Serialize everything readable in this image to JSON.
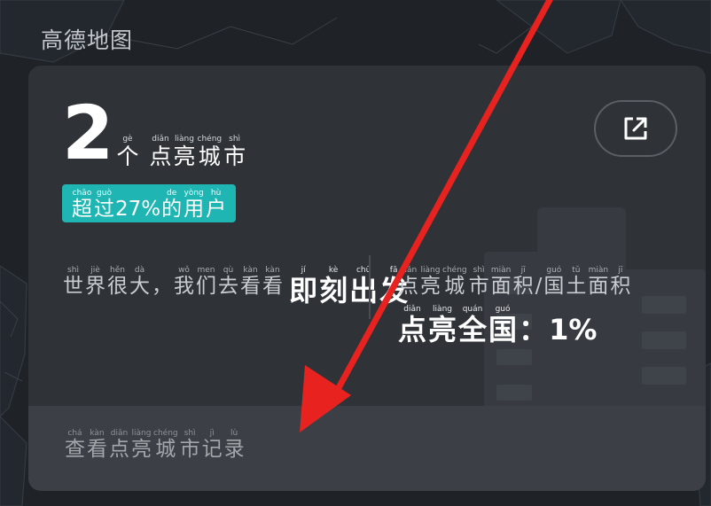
{
  "brand": {
    "logo_text": "高德地图"
  },
  "summary": {
    "count": "2",
    "unit": {
      "hz": "个",
      "py": "gè"
    },
    "label": [
      {
        "hz": "点",
        "py": "diǎn"
      },
      {
        "hz": "亮",
        "py": "liàng"
      },
      {
        "hz": "城",
        "py": "chéng"
      },
      {
        "hz": "市",
        "py": "shì"
      }
    ]
  },
  "share": {
    "icon": "share-external-icon"
  },
  "rank_badge": {
    "prefix": [
      {
        "hz": "超",
        "py": "chāo"
      },
      {
        "hz": "过",
        "py": "guò"
      }
    ],
    "percent": "27%",
    "suffix": [
      {
        "hz": "的",
        "py": "de"
      },
      {
        "hz": "用",
        "py": "yòng"
      },
      {
        "hz": "户",
        "py": "hù"
      }
    ],
    "color": "#1fb5b2"
  },
  "explore": {
    "subtitle": [
      {
        "hz": "世",
        "py": "shì"
      },
      {
        "hz": "界",
        "py": "jiè"
      },
      {
        "hz": "很",
        "py": "hěn"
      },
      {
        "hz": "大",
        "py": "dà"
      },
      {
        "hz": "，",
        "py": ""
      },
      {
        "hz": "我",
        "py": "wǒ"
      },
      {
        "hz": "们",
        "py": "men"
      },
      {
        "hz": "去",
        "py": "qù"
      },
      {
        "hz": "看",
        "py": "kàn"
      },
      {
        "hz": "看",
        "py": "kàn"
      }
    ],
    "title": [
      {
        "hz": "即",
        "py": "jí"
      },
      {
        "hz": "刻",
        "py": "kè"
      },
      {
        "hz": "出",
        "py": "chū"
      },
      {
        "hz": "发",
        "py": "fā"
      }
    ]
  },
  "coverage": {
    "subtitle": [
      {
        "hz": "点",
        "py": "diǎn"
      },
      {
        "hz": "亮",
        "py": "liàng"
      },
      {
        "hz": "城",
        "py": "chéng"
      },
      {
        "hz": "市",
        "py": "shì"
      },
      {
        "hz": "面",
        "py": "miàn"
      },
      {
        "hz": "积",
        "py": "jī"
      },
      {
        "hz": "/",
        "py": ""
      },
      {
        "hz": "国",
        "py": "guó"
      },
      {
        "hz": "土",
        "py": "tǔ"
      },
      {
        "hz": "面",
        "py": "miàn"
      },
      {
        "hz": "积",
        "py": "jī"
      }
    ],
    "title": [
      {
        "hz": "点",
        "py": "diǎn"
      },
      {
        "hz": "亮",
        "py": "liàng"
      },
      {
        "hz": "全",
        "py": "quán"
      },
      {
        "hz": "国",
        "py": "guó"
      },
      {
        "hz": "：",
        "py": ""
      },
      {
        "hz": "1%",
        "py": ""
      }
    ]
  },
  "footer": {
    "link": [
      {
        "hz": "查",
        "py": "chá"
      },
      {
        "hz": "看",
        "py": "kàn"
      },
      {
        "hz": "点",
        "py": "diǎn"
      },
      {
        "hz": "亮",
        "py": "liàng"
      },
      {
        "hz": "城",
        "py": "chéng"
      },
      {
        "hz": "市",
        "py": "shì"
      },
      {
        "hz": "记",
        "py": "jì"
      },
      {
        "hz": "录",
        "py": "lù"
      }
    ]
  },
  "annotation": {
    "arrow_color": "#e8231f"
  }
}
